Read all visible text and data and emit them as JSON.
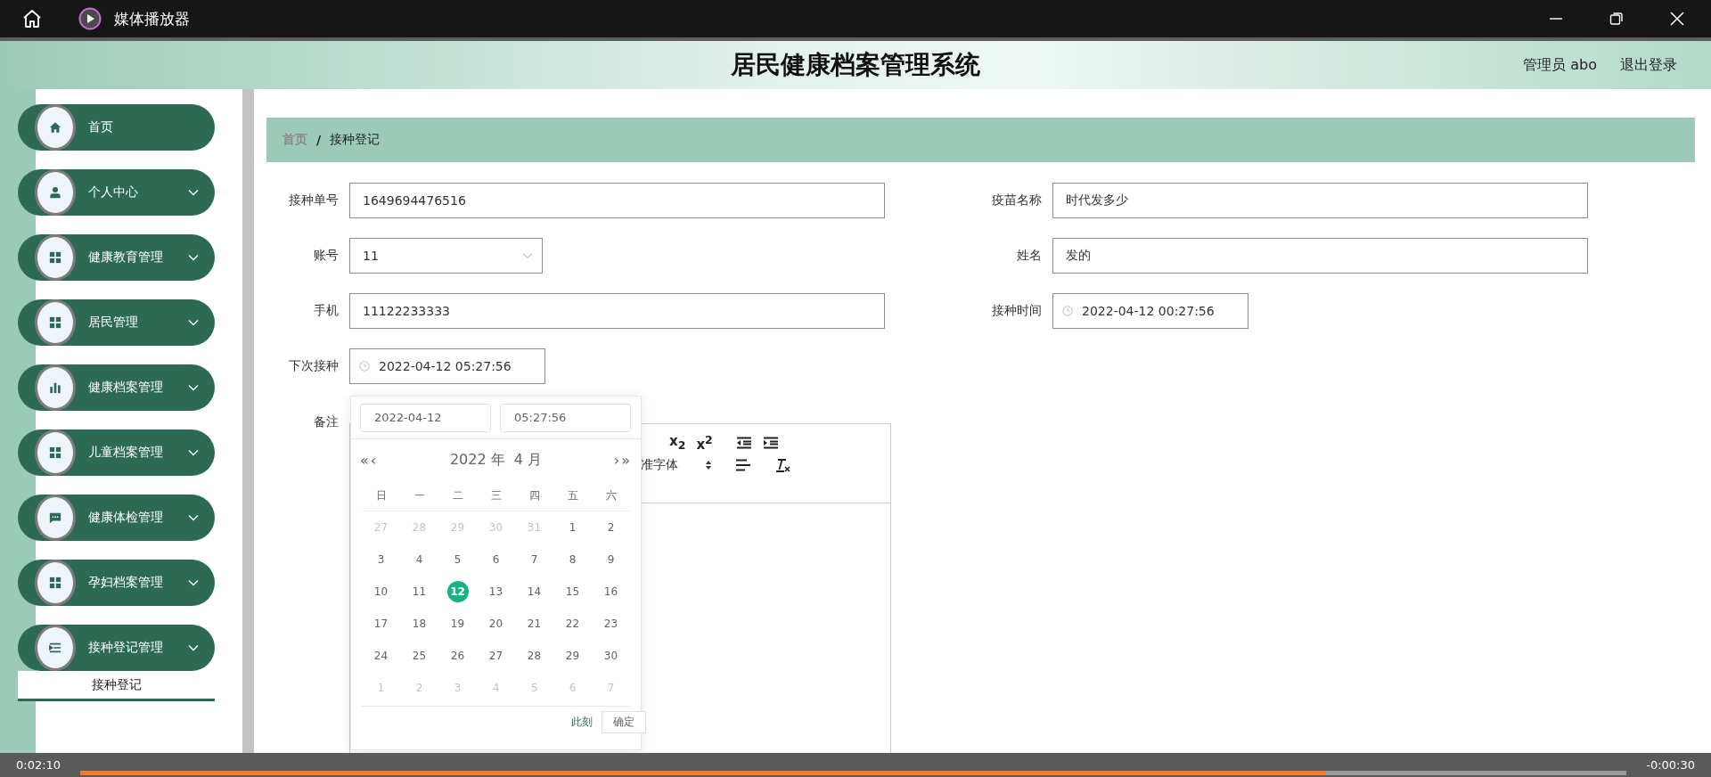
{
  "player": {
    "title": "媒体播放器",
    "elapsed": "0:02:10",
    "remaining": "-0:00:30",
    "level": 0.805
  },
  "header": {
    "title": "居民健康档案管理系统",
    "user": "管理员 abo",
    "logout": "退出登录"
  },
  "sidebar": {
    "items": [
      {
        "label": "首页",
        "kind": "home",
        "expandable": false
      },
      {
        "label": "个人中心",
        "kind": "user",
        "expandable": true
      },
      {
        "label": "健康教育管理",
        "kind": "grid",
        "expandable": true
      },
      {
        "label": "居民管理",
        "kind": "grid",
        "expandable": true
      },
      {
        "label": "健康档案管理",
        "kind": "chart",
        "expandable": true
      },
      {
        "label": "儿童档案管理",
        "kind": "grid",
        "expandable": true
      },
      {
        "label": "健康体检管理",
        "kind": "chat",
        "expandable": true
      },
      {
        "label": "孕妇档案管理",
        "kind": "grid",
        "expandable": true
      },
      {
        "label": "接种登记管理",
        "kind": "list",
        "expandable": true,
        "children": [
          {
            "label": "接种登记",
            "selected": true
          }
        ]
      }
    ]
  },
  "breadcrumb": {
    "separator": "/",
    "items": [
      {
        "label": "首页",
        "current": false
      },
      {
        "label": "接种登记",
        "current": true
      }
    ]
  },
  "form": {
    "fields": [
      {
        "label": "接种单号",
        "value": "1649694476516",
        "kind": "text"
      },
      {
        "label": "疫苗名称",
        "value": "时代发多少",
        "kind": "text"
      },
      {
        "label": "账号",
        "value": "11",
        "kind": "select"
      },
      {
        "label": "姓名",
        "value": "发的",
        "kind": "text"
      },
      {
        "label": "手机",
        "value": "11122233333",
        "kind": "text"
      },
      {
        "label": "接种时间",
        "value": "2022-04-12 00:27:56",
        "kind": "datetime"
      },
      {
        "label": "下次接种",
        "value": "2022-04-12 05:27:56",
        "kind": "datetime"
      }
    ],
    "remark": {
      "label": "备注",
      "toolbar": [
        [
          {
            "kind": "script",
            "text": "x$_{2}$"
          },
          {
            "kind": "script",
            "text": "x$^{2}$"
          },
          {
            "kind": "outdent"
          },
          {
            "kind": "indent"
          }
        ],
        [
          {
            "kind": "select",
            "text": "准字体"
          },
          {
            "kind": "align"
          },
          {
            "kind": "clean"
          }
        ]
      ]
    }
  },
  "date_picker": {
    "date": "2022-04-12",
    "time": "05:27:56",
    "prev_year": "«",
    "prev_month": "‹",
    "title": "2022 年  4 月",
    "next_month": "›",
    "next_year": "»",
    "weekdays": [
      "日",
      "一",
      "二",
      "三",
      "四",
      "五",
      "六"
    ],
    "days": [
      {
        "label": "27",
        "other_month": true,
        "selected": false
      },
      {
        "label": "28",
        "other_month": true,
        "selected": false
      },
      {
        "label": "29",
        "other_month": true,
        "selected": false
      },
      {
        "label": "30",
        "other_month": true,
        "selected": false
      },
      {
        "label": "31",
        "other_month": true,
        "selected": false
      },
      {
        "label": "1",
        "other_month": false,
        "selected": false
      },
      {
        "label": "2",
        "other_month": false,
        "selected": false
      },
      {
        "label": "3",
        "other_month": false,
        "selected": false
      },
      {
        "label": "4",
        "other_month": false,
        "selected": false
      },
      {
        "label": "5",
        "other_month": false,
        "selected": false
      },
      {
        "label": "6",
        "other_month": false,
        "selected": false
      },
      {
        "label": "7",
        "other_month": false,
        "selected": false
      },
      {
        "label": "8",
        "other_month": false,
        "selected": false
      },
      {
        "label": "9",
        "other_month": false,
        "selected": false
      },
      {
        "label": "10",
        "other_month": false,
        "selected": false
      },
      {
        "label": "11",
        "other_month": false,
        "selected": false
      },
      {
        "label": "12",
        "other_month": false,
        "selected": true
      },
      {
        "label": "13",
        "other_month": false,
        "selected": false
      },
      {
        "label": "14",
        "other_month": false,
        "selected": false
      },
      {
        "label": "15",
        "other_month": false,
        "selected": false
      },
      {
        "label": "16",
        "other_month": false,
        "selected": false
      },
      {
        "label": "17",
        "other_month": false,
        "selected": false
      },
      {
        "label": "18",
        "other_month": false,
        "selected": false
      },
      {
        "label": "19",
        "other_month": false,
        "selected": false
      },
      {
        "label": "20",
        "other_month": false,
        "selected": false
      },
      {
        "label": "21",
        "other_month": false,
        "selected": false
      },
      {
        "label": "22",
        "other_month": false,
        "selected": false
      },
      {
        "label": "23",
        "other_month": false,
        "selected": false
      },
      {
        "label": "24",
        "other_month": false,
        "selected": false
      },
      {
        "label": "25",
        "other_month": false,
        "selected": false
      },
      {
        "label": "26",
        "other_month": false,
        "selected": false
      },
      {
        "label": "27",
        "other_month": false,
        "selected": false
      },
      {
        "label": "28",
        "other_month": false,
        "selected": false
      },
      {
        "label": "29",
        "other_month": false,
        "selected": false
      },
      {
        "label": "30",
        "other_month": false,
        "selected": false
      },
      {
        "label": "1",
        "other_month": true,
        "selected": false
      },
      {
        "label": "2",
        "other_month": true,
        "selected": false
      },
      {
        "label": "3",
        "other_month": true,
        "selected": false
      },
      {
        "label": "4",
        "other_month": true,
        "selected": false
      },
      {
        "label": "5",
        "other_month": true,
        "selected": false
      },
      {
        "label": "6",
        "other_month": true,
        "selected": false
      },
      {
        "label": "7",
        "other_month": true,
        "selected": false
      }
    ],
    "now": "此刻",
    "confirm": "确定"
  }
}
